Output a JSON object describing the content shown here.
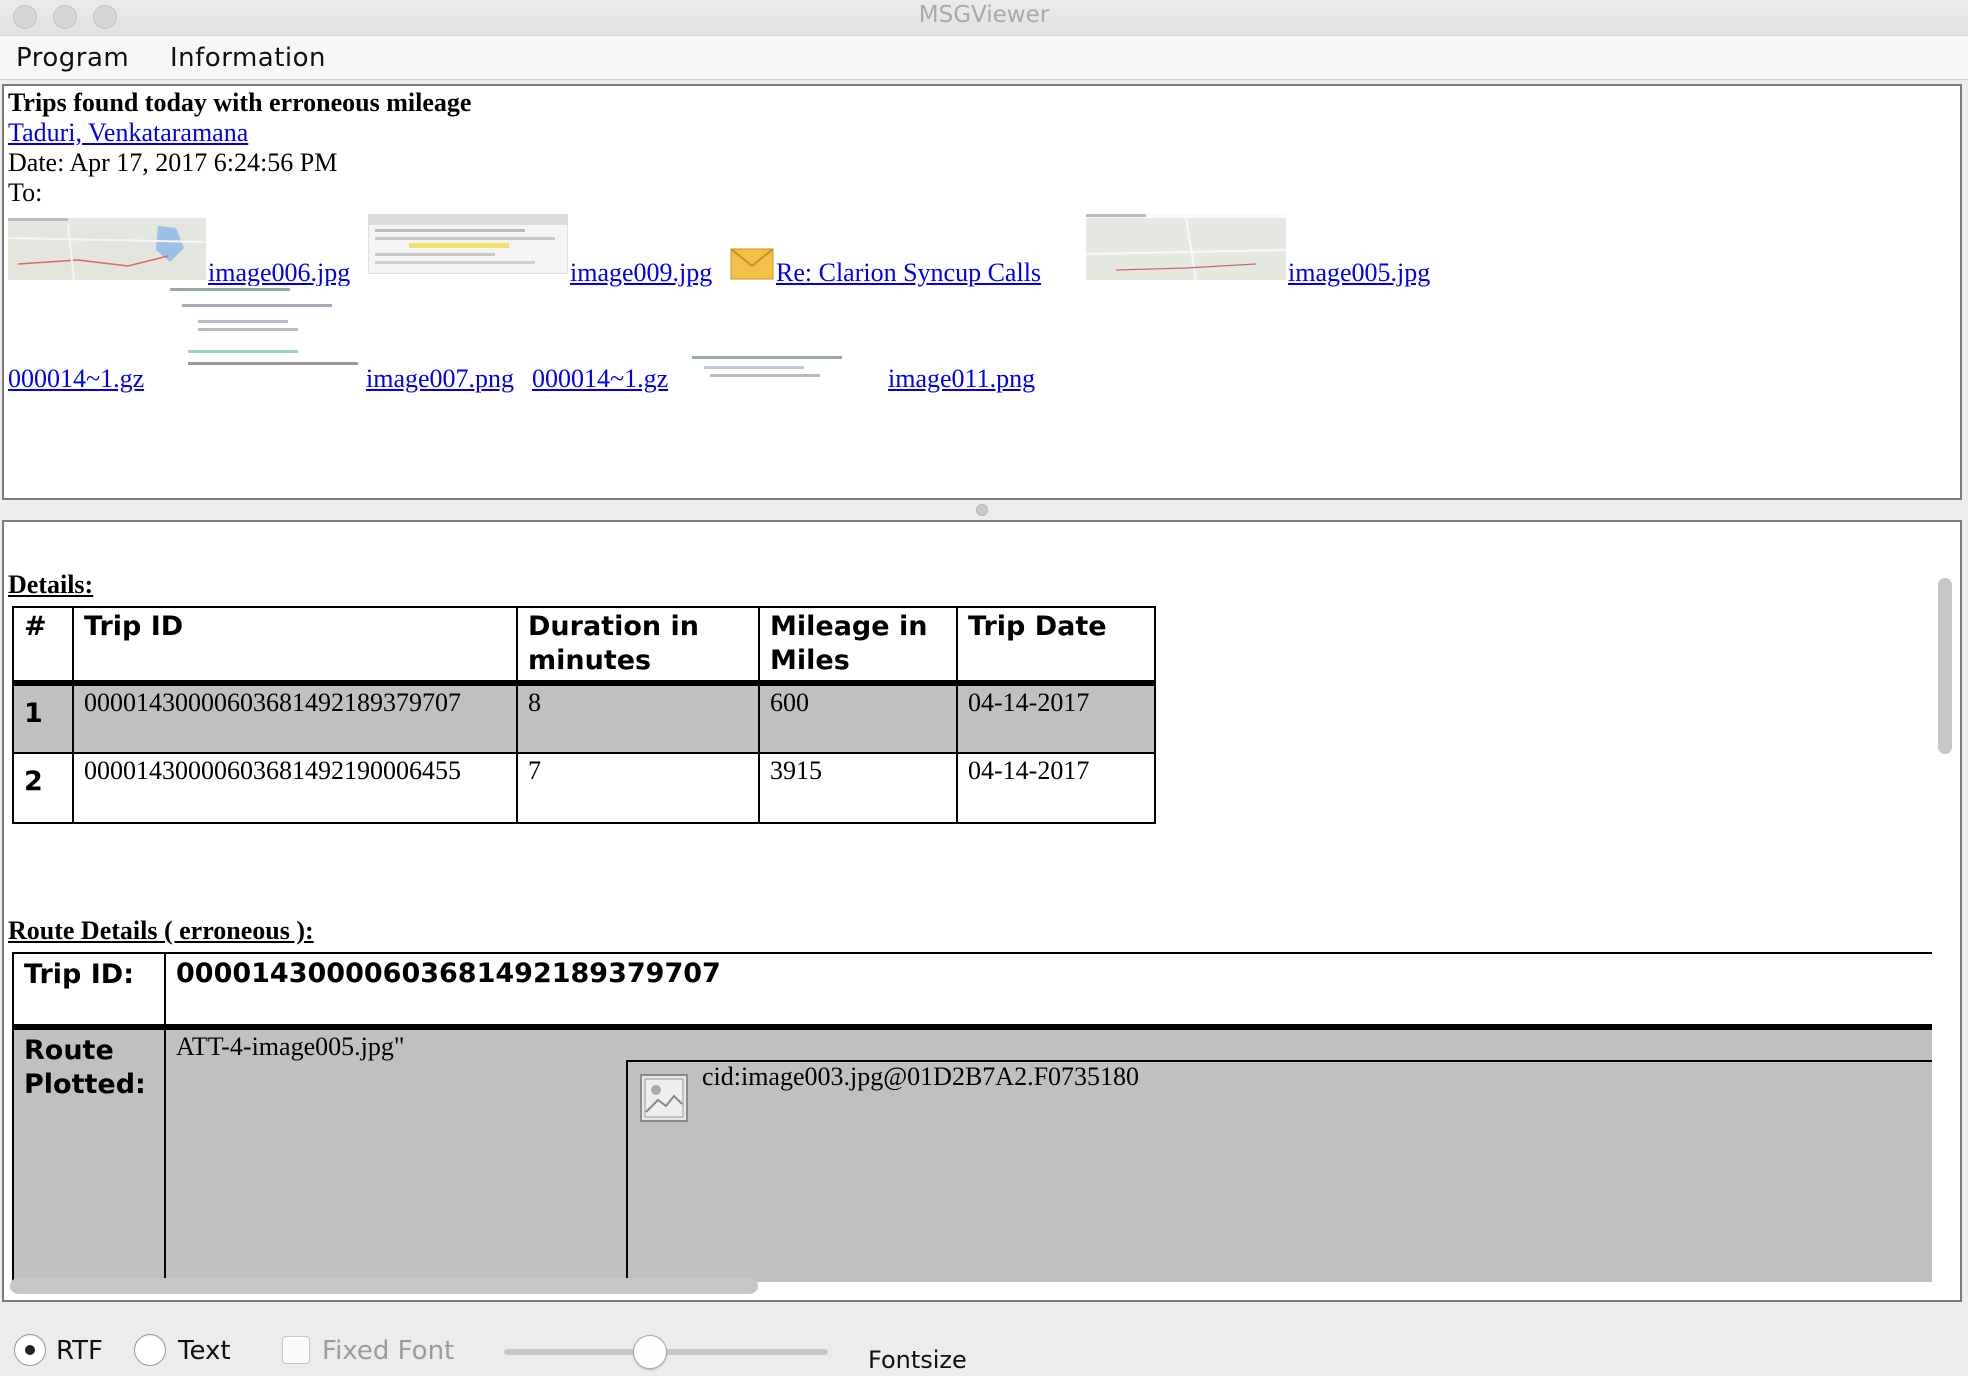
{
  "window": {
    "title": "MSGViewer"
  },
  "menu": {
    "items": [
      "Program",
      "Information"
    ]
  },
  "message": {
    "subject": "Trips found today with erroneous mileage",
    "from": "Taduri, Venkataramana",
    "date": "Date: Apr 17, 2017 6:24:56 PM",
    "to": "To:",
    "attachments": [
      {
        "name": "image006.jpg",
        "icon": "map-thumbnail"
      },
      {
        "name": "image009.jpg",
        "icon": "document-thumbnail"
      },
      {
        "name": "Re: Clarion Syncup Calls",
        "icon": "envelope-icon"
      },
      {
        "name": "image005.jpg",
        "icon": "map-thumbnail"
      },
      {
        "name": "000014~1.gz"
      },
      {
        "name": "image007.png",
        "icon": "code-thumbnail"
      },
      {
        "name": "000014~1.gz"
      },
      {
        "name": "image011.png",
        "icon": "code-thumbnail"
      }
    ]
  },
  "body": {
    "details_title": "Details:",
    "details_table": {
      "headers": [
        "#",
        "Trip ID",
        "Duration in minutes",
        "Mileage in Miles",
        "Trip Date"
      ],
      "rows": [
        [
          "1",
          "00001430000603681492189379707",
          "8",
          "600",
          "04-14-2017"
        ],
        [
          "2",
          "00001430000603681492190006455",
          "7",
          "3915",
          "04-14-2017"
        ]
      ]
    },
    "route_title": "Route Details ( erroneous ):",
    "route_table": {
      "trip_id_label": "Trip ID:",
      "trip_id_value": "00001430000603681492189379707",
      "route_label": "Route Plotted:",
      "route_value": "ATT-4-image005.jpg\"",
      "image_cid": "cid:image003.jpg@01D2B7A2.F0735180"
    }
  },
  "controls": {
    "rtf_label": "RTF",
    "text_label": "Text",
    "fixed_font_label": "Fixed Font",
    "fontsize_label": "Fontsize",
    "selected_mode": "RTF",
    "fixed_font_enabled": false,
    "fontsize_level": 0.45
  },
  "colors": {
    "link": "#0000ee",
    "shaded_row": "#c0c0c0"
  }
}
